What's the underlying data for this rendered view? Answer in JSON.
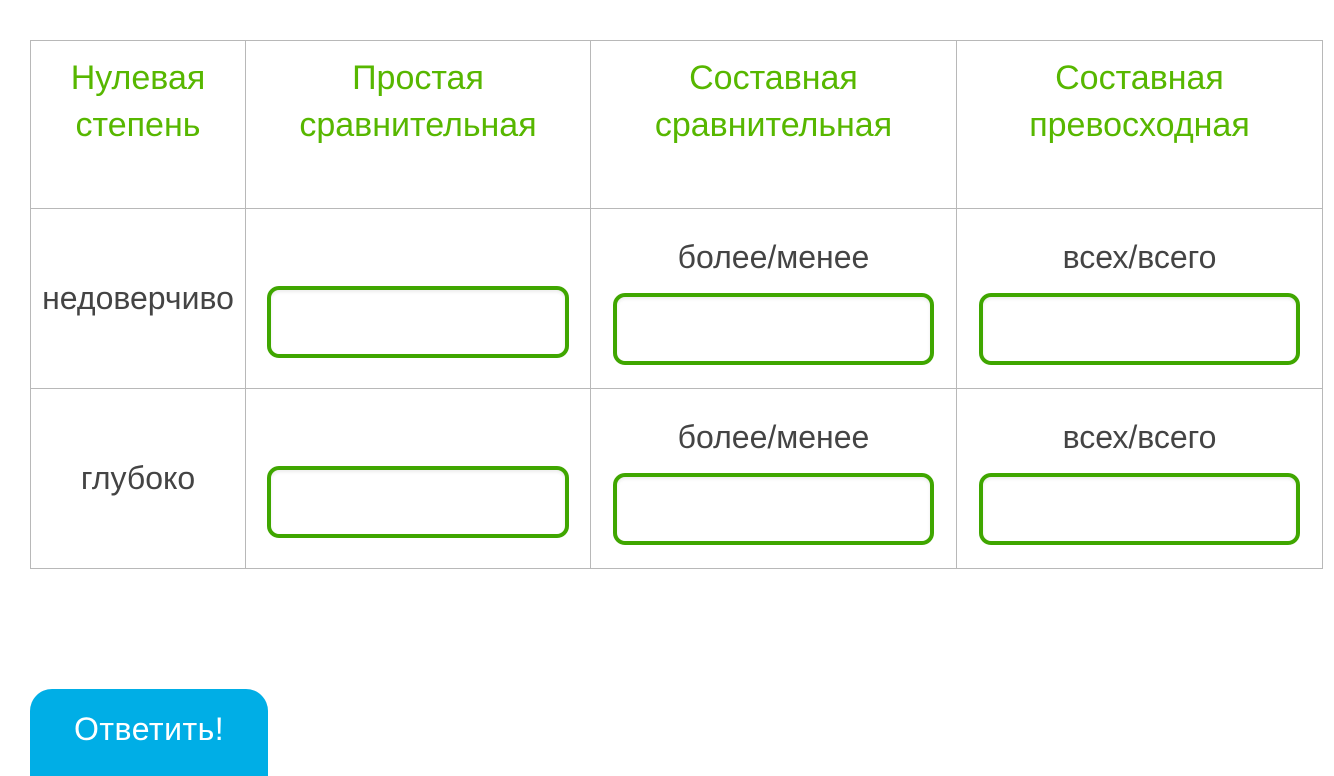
{
  "table": {
    "headers": {
      "zero": "Нулевая степень",
      "simple_comp": "Простая сравнительная",
      "compound_comp": "Составная сравнительная",
      "compound_super": "Составная превосходная"
    },
    "hints": {
      "compound_comp": "более/менее",
      "compound_super": "всех/всего"
    },
    "rows": [
      {
        "zero": "недоверчиво",
        "simple_comp": "",
        "compound_comp": "",
        "compound_super": ""
      },
      {
        "zero": "глубоко",
        "simple_comp": "",
        "compound_comp": "",
        "compound_super": ""
      }
    ]
  },
  "submit_label": "Ответить!"
}
